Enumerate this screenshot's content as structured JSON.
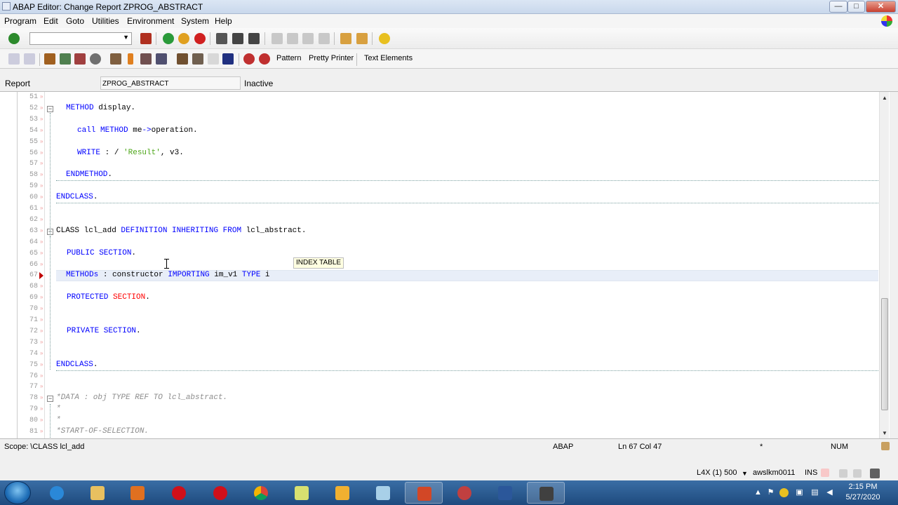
{
  "window": {
    "title": "ABAP Editor: Change Report ZPROG_ABSTRACT",
    "buttons": [
      "—",
      "□",
      "✕"
    ]
  },
  "menubar": [
    "Program",
    "Edit",
    "Goto",
    "Utilities",
    "Environment",
    "System",
    "Help"
  ],
  "toolbar2": {
    "pattern_label": "Pattern",
    "pretty_printer_label": "Pretty Printer",
    "text_elements_label": "Text Elements"
  },
  "header": {
    "type_label": "Report",
    "program_name": "ZPROG_ABSTRACT",
    "status": "Inactive"
  },
  "editor": {
    "lines": [
      {
        "n": "51",
        "parts": []
      },
      {
        "n": "52",
        "parts": [
          [
            "kw",
            "METHOD"
          ],
          [
            "",
            " display."
          ]
        ]
      },
      {
        "n": "53",
        "parts": []
      },
      {
        "n": "54",
        "parts": [
          [
            "kw",
            "call METHOD"
          ],
          [
            "",
            " me"
          ],
          [
            "kw",
            "->"
          ],
          [
            "",
            "operation."
          ]
        ]
      },
      {
        "n": "55",
        "parts": []
      },
      {
        "n": "56",
        "parts": [
          [
            "kw",
            "WRITE"
          ],
          [
            "",
            " : / "
          ],
          [
            "str",
            "'Result'"
          ],
          [
            "",
            ", v3."
          ]
        ]
      },
      {
        "n": "57",
        "parts": []
      },
      {
        "n": "58",
        "parts": [
          [
            "kw",
            "ENDMETHOD"
          ],
          [
            "",
            "."
          ]
        ]
      },
      {
        "n": "59",
        "parts": []
      },
      {
        "n": "60",
        "parts": [
          [
            "kw",
            "ENDCLASS"
          ],
          [
            "",
            "."
          ]
        ]
      },
      {
        "n": "61",
        "parts": []
      },
      {
        "n": "62",
        "parts": []
      },
      {
        "n": "63",
        "parts": [
          [
            "",
            "CLASS lcl_add "
          ],
          [
            "kw",
            "DEFINITION INHERITING FROM"
          ],
          [
            "",
            " lcl_abstract."
          ]
        ]
      },
      {
        "n": "64",
        "parts": []
      },
      {
        "n": "65",
        "parts": [
          [
            "kw",
            "PUBLIC SECTION"
          ],
          [
            "",
            "."
          ]
        ]
      },
      {
        "n": "66",
        "parts": []
      },
      {
        "n": "67",
        "parts": [
          [
            "kw",
            "METHODs"
          ],
          [
            "",
            " : constructor "
          ],
          [
            "kw",
            "IMPORTING"
          ],
          [
            "",
            " im_v1 "
          ],
          [
            "kw",
            "TYPE"
          ],
          [
            "",
            " i"
          ]
        ]
      },
      {
        "n": "68",
        "parts": []
      },
      {
        "n": "69",
        "parts": [
          [
            "kw",
            "PROTECTED"
          ],
          [
            "",
            " "
          ],
          [
            "kwr",
            "SECTION"
          ],
          [
            "",
            "."
          ]
        ]
      },
      {
        "n": "70",
        "parts": []
      },
      {
        "n": "71",
        "parts": []
      },
      {
        "n": "72",
        "parts": [
          [
            "kw",
            "PRIVATE SECTION"
          ],
          [
            "",
            "."
          ]
        ]
      },
      {
        "n": "73",
        "parts": []
      },
      {
        "n": "74",
        "parts": []
      },
      {
        "n": "75",
        "parts": [
          [
            "kw",
            "ENDCLASS"
          ],
          [
            "",
            "."
          ]
        ]
      },
      {
        "n": "76",
        "parts": []
      },
      {
        "n": "77",
        "parts": []
      },
      {
        "n": "78",
        "parts": [
          [
            "cm",
            "*DATA : obj TYPE REF TO lcl_abstract."
          ]
        ]
      },
      {
        "n": "79",
        "parts": [
          [
            "cm",
            "*"
          ]
        ]
      },
      {
        "n": "80",
        "parts": [
          [
            "cm",
            "*"
          ]
        ]
      },
      {
        "n": "81",
        "parts": [
          [
            "cm",
            "*START-OF-SELECTION."
          ]
        ]
      }
    ],
    "tooltip": "INDEX TABLE"
  },
  "statusbar": {
    "scope": "Scope: \\CLASS lcl_add",
    "language": "ABAP",
    "position": "Ln 67 Col 47",
    "modified": "*",
    "num": "NUM"
  },
  "sapstatus": {
    "system": "L4X (1) 500",
    "server": "awslkm0011",
    "mode": "INS"
  },
  "taskbar": {
    "time": "2:15 PM",
    "date": "5/27/2020"
  },
  "colors": {
    "keyword": "#0000ff",
    "keyword_red": "#ff0000",
    "string": "#4da619",
    "comment": "#8c8c8c",
    "taskbar": "#1e4a7e"
  }
}
